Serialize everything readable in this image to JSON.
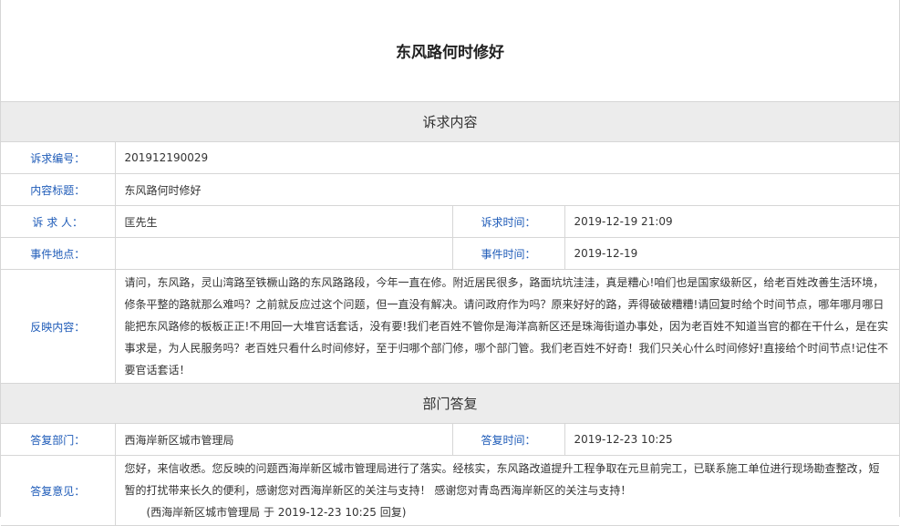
{
  "page_title": "东风路何时修好",
  "sections": {
    "complaint": "诉求内容",
    "reply": "部门答复"
  },
  "complaint": {
    "id_label": "诉求编号：",
    "id_value": "201912190029",
    "subject_label": "内容标题：",
    "subject_value": "东风路何时修好",
    "complainant_label": "诉 求 人：",
    "complainant_value": "匡先生",
    "time_label": "诉求时间：",
    "time_value": "2019-12-19 21:09",
    "location_label": "事件地点：",
    "location_value": "",
    "event_time_label": "事件时间：",
    "event_time_value": "2019-12-19",
    "content_label": "反映内容：",
    "content_value": "请问，东风路，灵山湾路至铁橛山路的东风路路段，今年一直在修。附近居民很多，路面坑坑洼洼，真是糟心!咱们也是国家级新区，给老百姓改善生活环境，修条平整的路就那么难吗？之前就反应过这个问题，但一直没有解决。请问政府作为吗？原来好好的路，弄得破破糟糟!请回复时给个时间节点，哪年哪月哪日能把东风路修的板板正正!不用回一大堆官话套话，没有要!我们老百姓不管你是海洋高新区还是珠海街道办事处，因为老百姓不知道当官的都在干什么，是在实事求是，为人民服务吗？老百姓只看什么时间修好，至于归哪个部门修，哪个部门管。我们老百姓不好奇！我们只关心什么时间修好!直接给个时间节点!记住不要官话套话！"
  },
  "reply": {
    "dept_label": "答复部门：",
    "dept_value": "西海岸新区城市管理局",
    "time_label": "答复时间：",
    "time_value": "2019-12-23 10:25",
    "opinion_label": "答复意见：",
    "opinion_value": "您好，来信收悉。您反映的问题西海岸新区城市管理局进行了落实。经核实，东风路改道提升工程争取在元旦前完工，已联系施工单位进行现场勘查整改，短暂的打扰带来长久的便利，感谢您对西海岸新区的关注与支持！ 感谢您对青岛西海岸新区的关注与支持！",
    "signature": "(西海岸新区城市管理局 于 2019-12-23 10:25 回复)"
  }
}
